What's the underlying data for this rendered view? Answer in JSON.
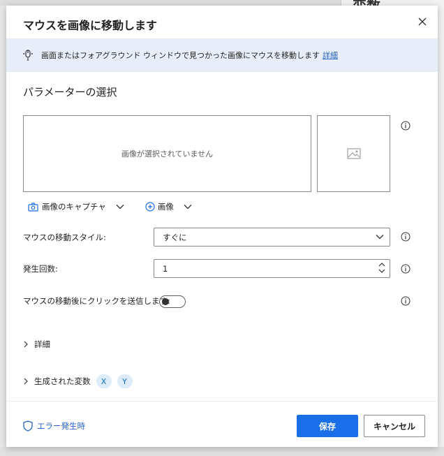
{
  "background": {
    "right_panel_title": "変数"
  },
  "dialog": {
    "title": "マウスを画像に移動します",
    "close_icon": "close-icon",
    "info": {
      "description": "画面またはフォアグラウンド ウィンドウで見つかった画像にマウスを移動します",
      "link": "詳細"
    },
    "section_title": "パラメーターの選択",
    "image_placeholder": "画像が選択されていません",
    "capture_label": "画像のキャプチャ",
    "add_image_label": "画像",
    "fields": {
      "move_style_label": "マウスの移動スタイル:",
      "move_style_value": "すぐに",
      "occurrence_label": "発生回数:",
      "occurrence_value": "1",
      "click_after_label": "マウスの移動後にクリックを送信します:",
      "click_after_enabled": false
    },
    "details_label": "詳細",
    "generated_vars_label": "生成された変数",
    "generated_vars": [
      "X",
      "Y"
    ],
    "on_error_label": "エラー発生時",
    "save_label": "保存",
    "cancel_label": "キャンセル"
  },
  "colors": {
    "accent": "#1a6ee8",
    "link": "#2864c8",
    "info_bar": "#e8eef9",
    "chip_bg": "#deecf9"
  }
}
